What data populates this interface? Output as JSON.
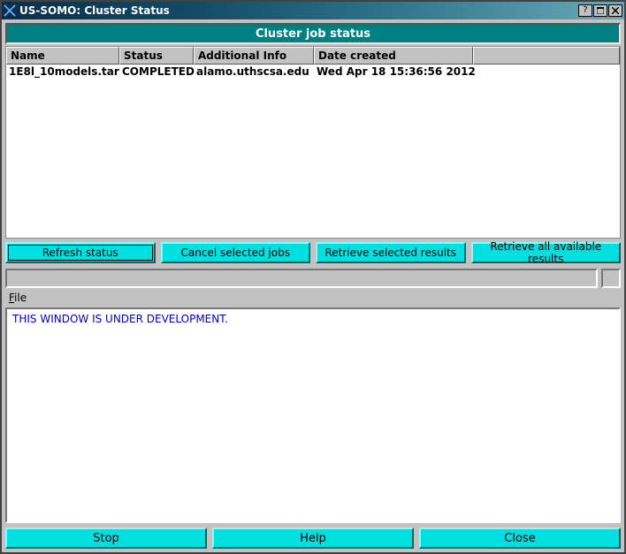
{
  "titlebar": {
    "title": "US-SOMO: Cluster Status"
  },
  "banner": "Cluster job status",
  "table": {
    "headers": {
      "name": "Name",
      "status": "Status",
      "info": "Additional Info",
      "date": "Date created"
    },
    "rows": [
      {
        "name": "1E8l_10models.tar",
        "status": "COMPLETED",
        "info": "alamo.uthscsa.edu",
        "date": "Wed Apr 18 15:36:56 2012"
      }
    ]
  },
  "buttons": {
    "refresh": "Refresh status",
    "cancel": "Cancel selected jobs",
    "retrieve_sel": "Retrieve selected results",
    "retrieve_all": "Retrieve all available results"
  },
  "menu": {
    "file_rest": "ile"
  },
  "log": "THIS WINDOW IS UNDER DEVELOPMENT.",
  "bottom": {
    "stop": "Stop",
    "help": "Help",
    "close": "Close"
  }
}
